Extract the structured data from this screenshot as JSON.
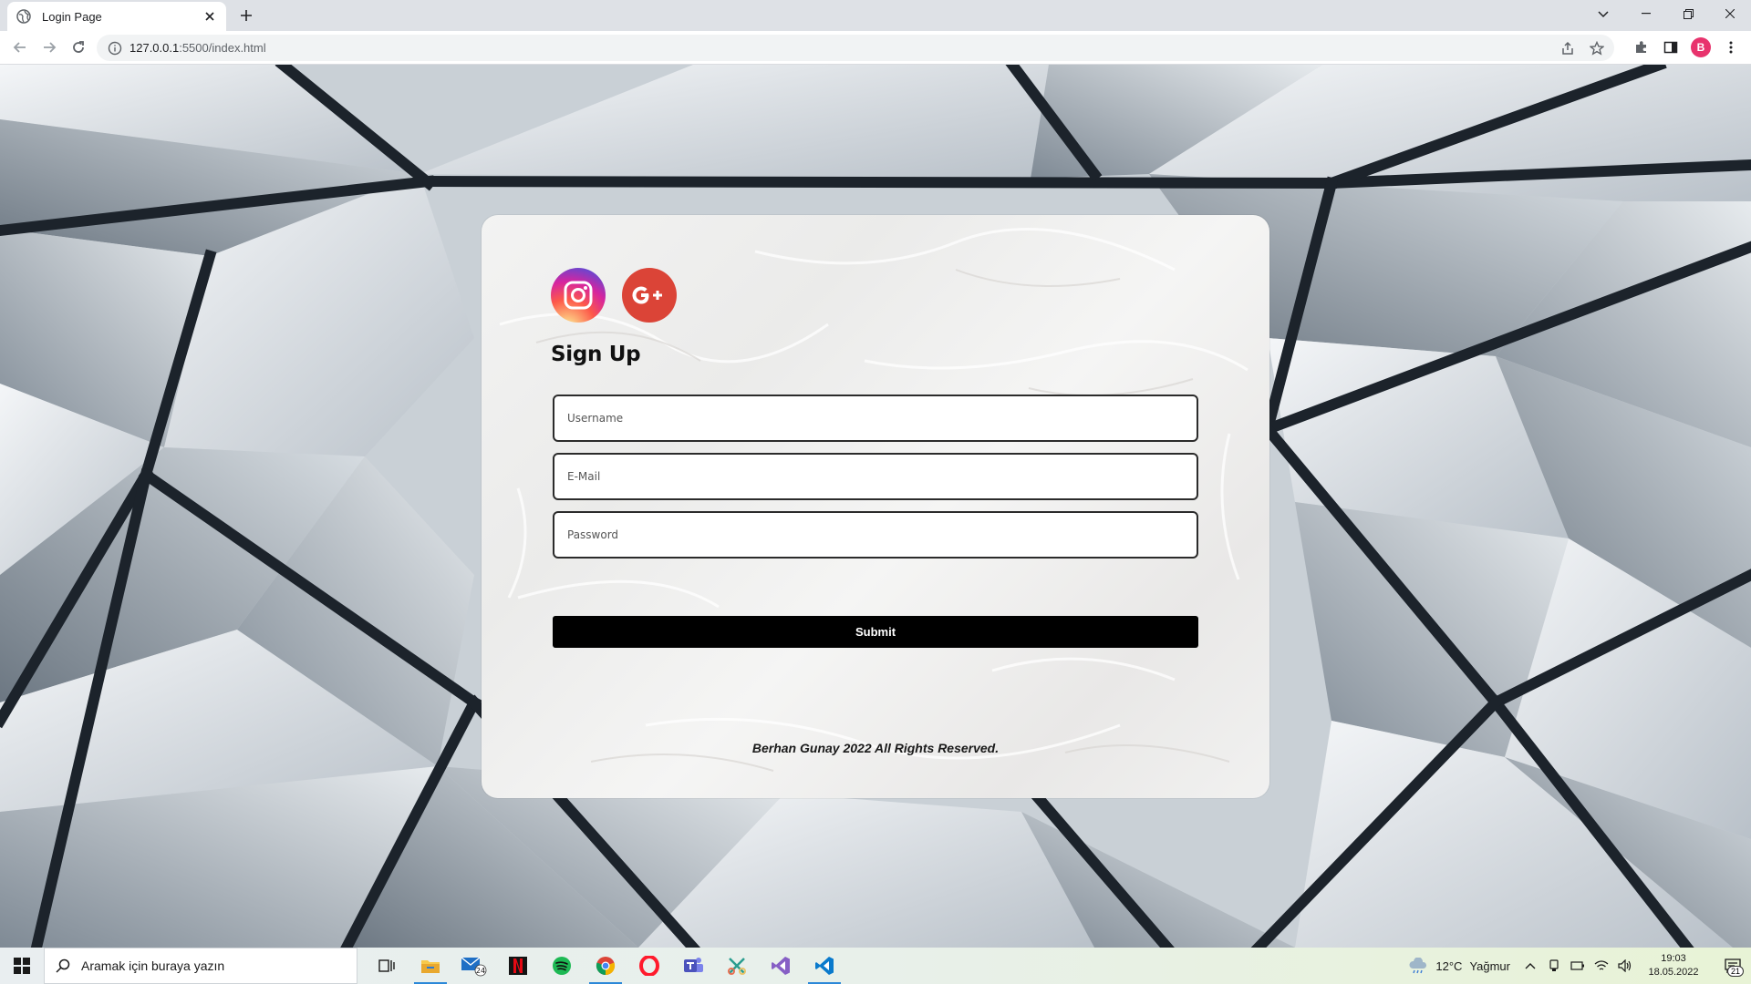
{
  "browser": {
    "tab_title": "Login Page",
    "url_host": "127.0.0.1",
    "url_rest": ":5500/index.html",
    "profile_initial": "B"
  },
  "page": {
    "title": "Sign Up",
    "fields": {
      "username_placeholder": "Username",
      "email_placeholder": "E-Mail",
      "password_placeholder": "Password"
    },
    "submit_label": "Submit",
    "footer": "Berhan Gunay 2022 All Rights Reserved.",
    "social": [
      "instagram-icon",
      "google-plus-icon"
    ]
  },
  "taskbar": {
    "search_placeholder": "Aramak için buraya yazın",
    "mail_badge": "24",
    "weather_temp": "12°C",
    "weather_desc": "Yağmur",
    "time": "19:03",
    "date": "18.05.2022",
    "notification_count": "21"
  },
  "colors": {
    "submit_bg": "#000000",
    "google_red": "#db4437",
    "profile_pink": "#e8336d"
  }
}
